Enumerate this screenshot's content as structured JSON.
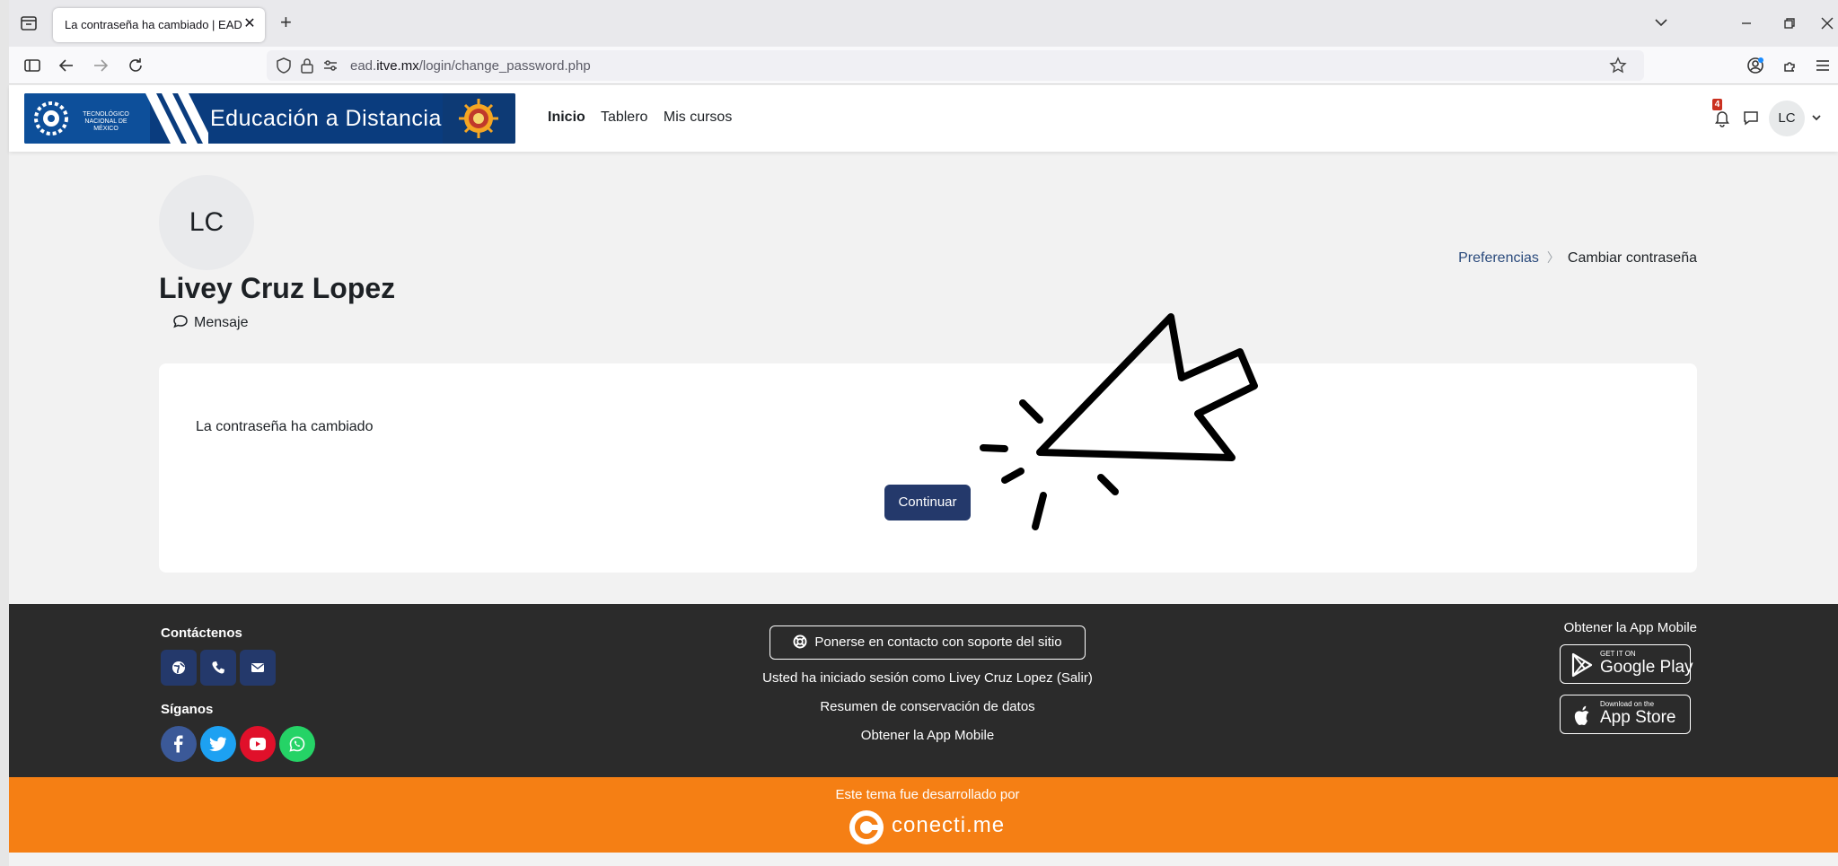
{
  "browser": {
    "tab_title": "La contraseña ha cambiado | EAD",
    "tab_close": "✕",
    "new_tab": "+",
    "url_prefix": "ead.",
    "url_domain": "itve.mx",
    "url_path": "/login/change_password.php"
  },
  "header": {
    "logo_small": "TECNOLÓGICO NACIONAL DE MÉXICO",
    "logo_title": "Educación a Distancia",
    "nav": [
      "Inicio",
      "Tablero",
      "Mis cursos"
    ],
    "notification_count": "4",
    "user_initials": "LC"
  },
  "profile": {
    "initials": "LC",
    "name": "Livey Cruz Lopez",
    "message_label": "Mensaje"
  },
  "breadcrumb": {
    "parent": "Preferencias",
    "current": "Cambiar contraseña"
  },
  "main": {
    "message": "La contraseña ha cambiado",
    "continue_label": "Continuar"
  },
  "footer": {
    "contact_heading": "Contáctenos",
    "follow_heading": "Síganos",
    "support_label": "Ponerse en contacto con soporte del sitio",
    "logged_in_text": "Usted ha iniciado sesión como Livey Cruz Lopez (Salir)",
    "data_retention": "Resumen de conservación de datos",
    "app_link": "Obtener la App Mobile",
    "app_heading": "Obtener la App Mobile",
    "google_small": "GET IT ON",
    "google_big": "Google Play",
    "apple_small": "Download on the",
    "apple_big": "App Store"
  },
  "credit": {
    "text": "Este tema fue desarrollado por",
    "brand": "conecti.me"
  },
  "colors": {
    "primary": "#24396b",
    "footer_bg": "#2b2b2b",
    "credit_bg": "#f57f14",
    "facebook": "#3b5998",
    "twitter": "#1da1f2",
    "youtube": "#e0102a",
    "whatsapp": "#25d366"
  }
}
